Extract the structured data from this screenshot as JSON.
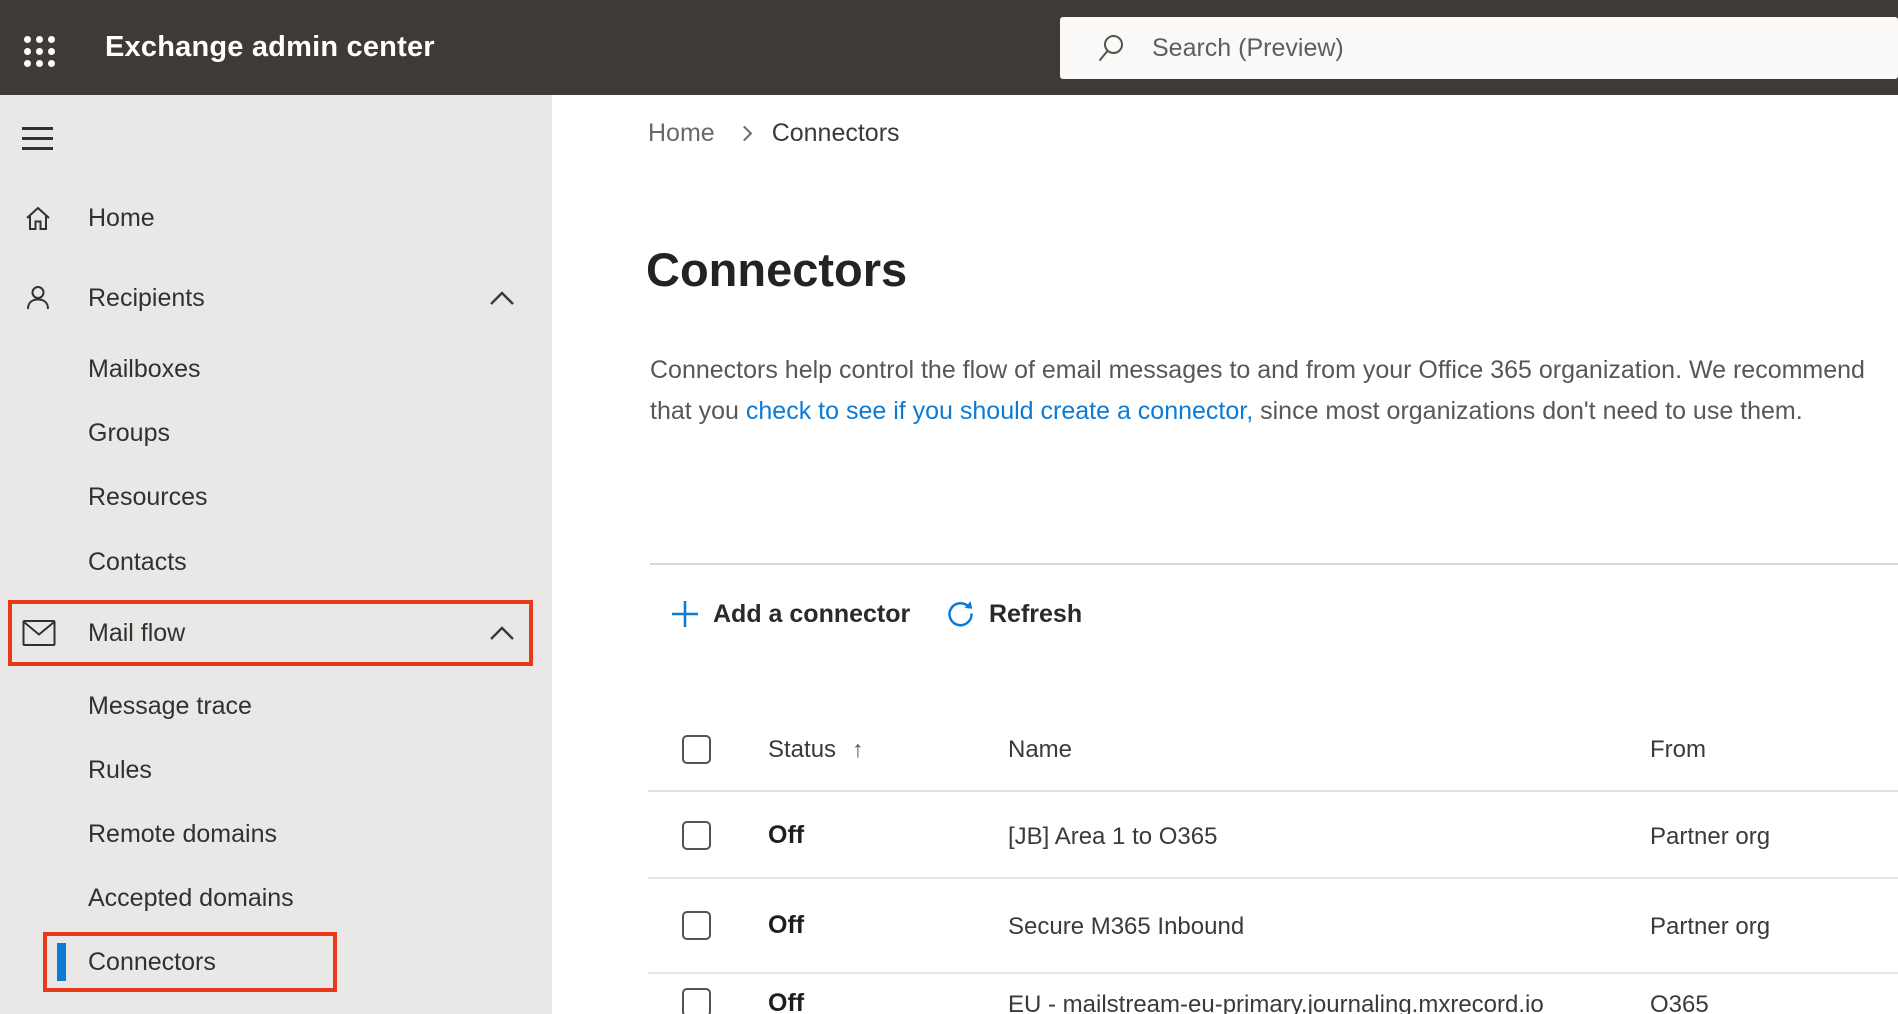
{
  "topbar": {
    "title": "Exchange admin center",
    "search": {
      "placeholder": "Search (Preview)"
    }
  },
  "sidebar": {
    "items": [
      {
        "label": "Home"
      },
      {
        "label": "Recipients"
      },
      {
        "label": "Mailboxes"
      },
      {
        "label": "Groups"
      },
      {
        "label": "Resources"
      },
      {
        "label": "Contacts"
      },
      {
        "label": "Mail flow"
      },
      {
        "label": "Message trace"
      },
      {
        "label": "Rules"
      },
      {
        "label": "Remote domains"
      },
      {
        "label": "Accepted domains"
      },
      {
        "label": "Connectors"
      }
    ]
  },
  "breadcrumb": {
    "home": "Home",
    "current": "Connectors"
  },
  "page": {
    "title": "Connectors",
    "desc_1": "Connectors help control the flow of email messages to and from your Office 365 organization. We recommend that you ",
    "desc_link": "check to see if you should create a connector,",
    "desc_2": " since most organizations don't need to use them."
  },
  "toolbar": {
    "add_label": "Add a connector",
    "refresh_label": "Refresh"
  },
  "table": {
    "headers": {
      "status": "Status",
      "name": "Name",
      "from": "From"
    },
    "sort_glyph": "↑",
    "rows": [
      {
        "status": "Off",
        "name": "[JB] Area 1 to O365",
        "from": "Partner org"
      },
      {
        "status": "Off",
        "name": "Secure M365 Inbound",
        "from": "Partner org"
      },
      {
        "status": "Off",
        "name": "EU - mailstream-eu-primary.journaling.mxrecord.io",
        "from": "O365"
      }
    ]
  },
  "colors": {
    "accent_blue": "#0b7bd6",
    "annotation_red": "#e83a18",
    "topbar_bg": "#3d3a38",
    "sidebar_bg": "#e9e8e6"
  }
}
